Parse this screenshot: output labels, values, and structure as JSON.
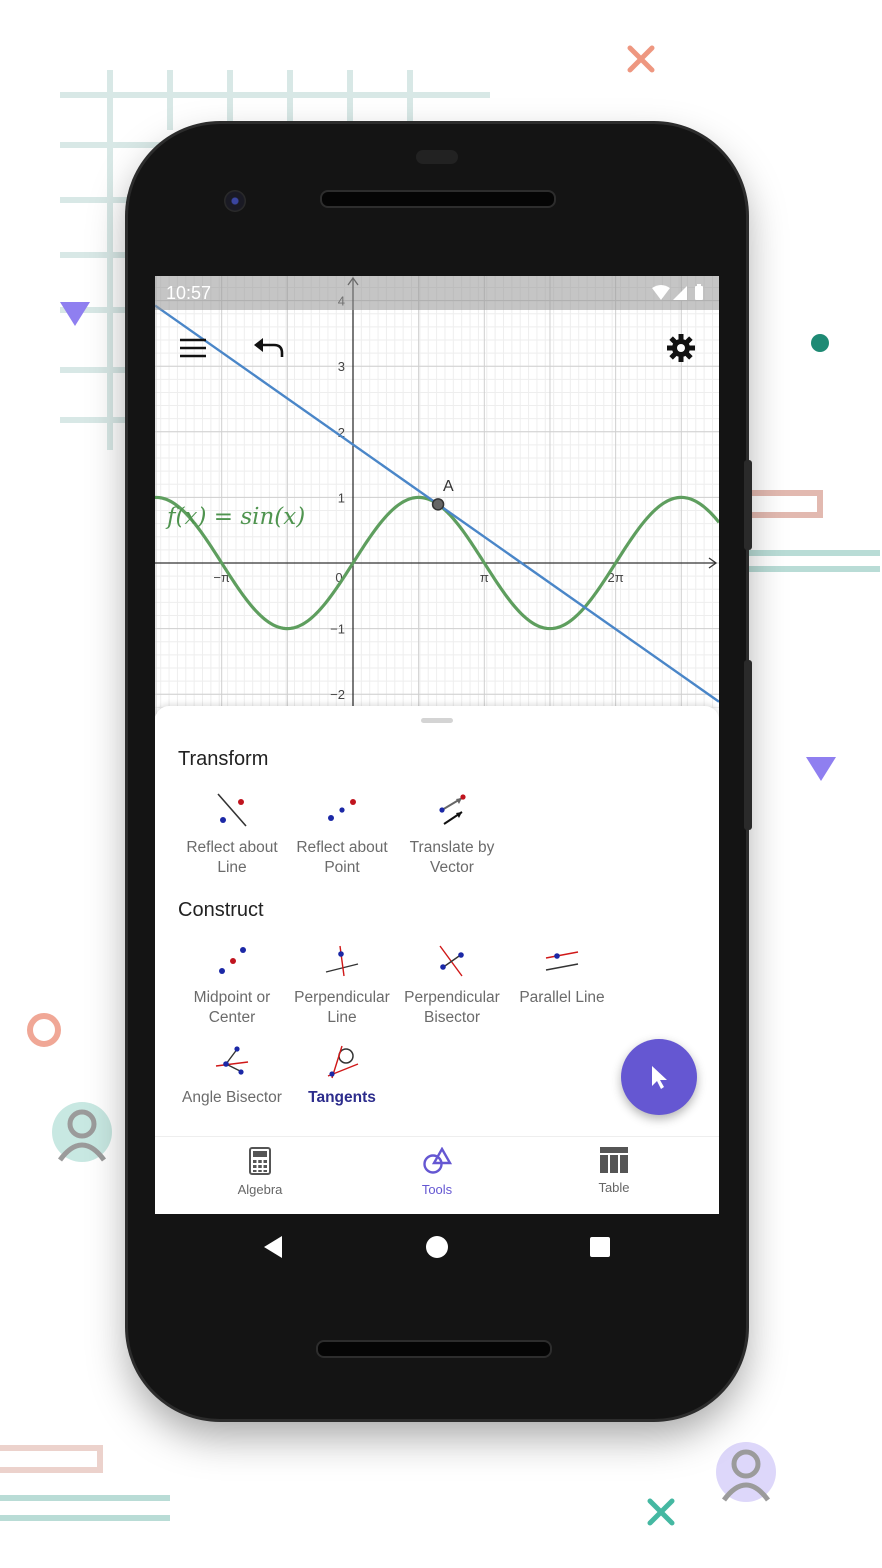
{
  "status_bar": {
    "time": "10:57"
  },
  "toolbar": {
    "menu_icon": "menu-icon",
    "undo_icon": "undo-icon",
    "settings_icon": "gear-icon"
  },
  "graph": {
    "function_label": "f(x) = sin(x)",
    "point_label": "A",
    "y_ticks": [
      "4",
      "3",
      "2",
      "1",
      "−1",
      "−2"
    ],
    "x_ticks": [
      "−π",
      "0",
      "π",
      "2π"
    ],
    "function_color": "#5e9e5e",
    "line_color": "#4a86c8"
  },
  "tools": {
    "sections": [
      {
        "title": "Transform"
      },
      {
        "title": "Construct"
      }
    ],
    "items": [
      {
        "label": "Reflect about Line",
        "icon": "reflect-line-icon"
      },
      {
        "label": "Reflect about Point",
        "icon": "reflect-point-icon"
      },
      {
        "label": "Translate by Vector",
        "icon": "translate-vector-icon"
      },
      {
        "label": "Midpoint or Center",
        "icon": "midpoint-icon"
      },
      {
        "label": "Perpendicular Line",
        "icon": "perpendicular-line-icon"
      },
      {
        "label": "Perpendicular Bisector",
        "icon": "perpendicular-bisector-icon"
      },
      {
        "label": "Parallel Line",
        "icon": "parallel-line-icon"
      },
      {
        "label": "Angle Bisector",
        "icon": "angle-bisector-icon"
      },
      {
        "label": "Tangents",
        "icon": "tangents-icon",
        "selected": true
      }
    ]
  },
  "bottom_nav": {
    "items": [
      {
        "label": "Algebra",
        "icon": "calculator-icon"
      },
      {
        "label": "Tools",
        "icon": "tools-icon",
        "active": true
      },
      {
        "label": "Table",
        "icon": "table-icon"
      }
    ]
  },
  "colors": {
    "accent": "#6557d2",
    "selected_tool": "#2c2c8c"
  }
}
